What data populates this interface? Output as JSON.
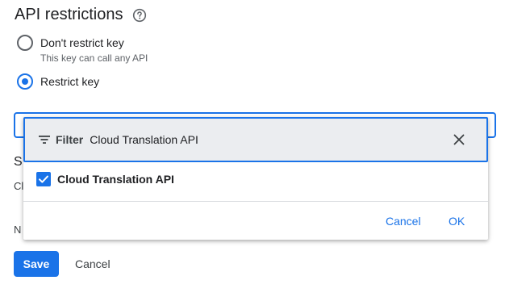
{
  "section": {
    "title": "API restrictions"
  },
  "radios": {
    "dont_restrict": {
      "label": "Don't restrict key",
      "sub": "This key can call any API",
      "checked": false
    },
    "restrict": {
      "label": "Restrict key",
      "checked": true
    }
  },
  "behind": {
    "heading_fragment": "S",
    "line_fragment": "Cl",
    "note_fragment": "N"
  },
  "dropdown": {
    "filter_label": "Filter",
    "filter_value": "Cloud Translation API",
    "option_label": "Cloud Translation API",
    "option_checked": true,
    "cancel_label": "Cancel",
    "ok_label": "OK"
  },
  "actions": {
    "save_label": "Save",
    "cancel_label": "Cancel"
  },
  "colors": {
    "accent": "#1a73e8",
    "filter_bg": "#ebedf0",
    "text": "#202124",
    "secondary_text": "#5f6368"
  },
  "icons": {
    "help": "help-circle-icon",
    "filter": "filter-icon",
    "clear": "close-icon",
    "check": "check-icon"
  }
}
